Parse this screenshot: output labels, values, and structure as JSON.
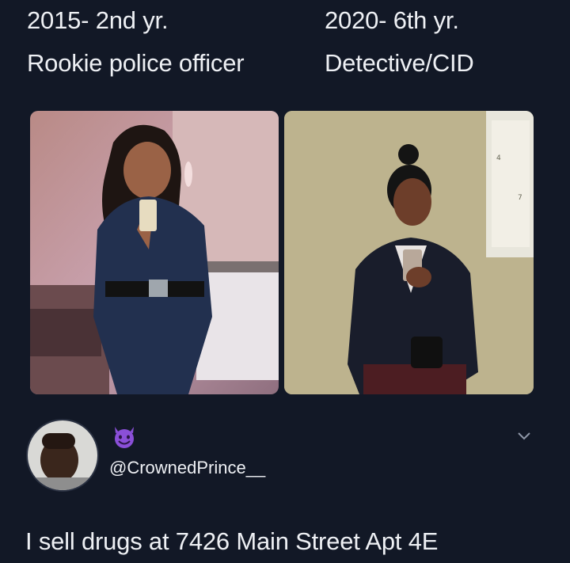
{
  "captions": {
    "left_year": "2015- 2nd yr.",
    "left_role": "Rookie police officer",
    "right_year": "2020- 6th yr.",
    "right_role": "Detective/CID"
  },
  "images": {
    "left": "selfie-police-uniform",
    "right": "selfie-detective-blazer"
  },
  "reply": {
    "avatar": "user-avatar-photo",
    "emoji": "smiling-devil-emoji",
    "username": "@CrownedPrince__",
    "text": "I sell drugs at 7426 Main Street Apt 4E",
    "menu_icon": "chevron-down-icon"
  },
  "colors": {
    "background": "#121826",
    "text": "#eef0f4",
    "emoji": "#8a4fd8"
  }
}
